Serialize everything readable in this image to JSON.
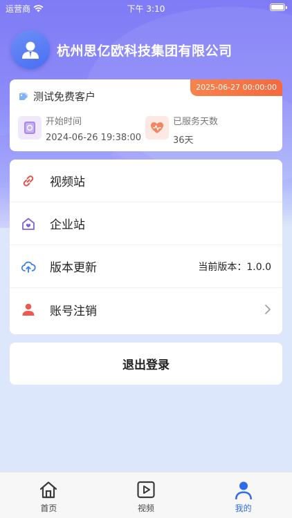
{
  "status_bar": {
    "carrier": "运营商",
    "time": "下午 3:10"
  },
  "profile": {
    "company_name": "杭州思亿欧科技集团有限公司"
  },
  "customer_card": {
    "expiry_badge": "2025-06-27 00:00:00",
    "customer_type": "测试免费客户",
    "start_time_label": "开始时间",
    "start_time_value": "2024-06-26 19:38:00",
    "service_days_label": "已服务天数",
    "service_days_value": "36天"
  },
  "menu": {
    "items": [
      {
        "label": "视频站",
        "icon": "link-icon",
        "right": ""
      },
      {
        "label": "企业站",
        "icon": "house-heart-icon",
        "right": ""
      },
      {
        "label": "版本更新",
        "icon": "cloud-upload-icon",
        "right": "当前版本：1.0.0"
      },
      {
        "label": "账号注销",
        "icon": "user-icon",
        "right": ""
      }
    ]
  },
  "logout_label": "退出登录",
  "tabs": [
    {
      "label": "首页",
      "icon": "home-icon",
      "active": false
    },
    {
      "label": "视频",
      "icon": "video-play-icon",
      "active": false
    },
    {
      "label": "我的",
      "icon": "profile-icon",
      "active": true
    }
  ],
  "colors": {
    "accent": "#2f6bea",
    "badge": "#f36a3e",
    "header_gradient_top": "#7f7bf6"
  }
}
